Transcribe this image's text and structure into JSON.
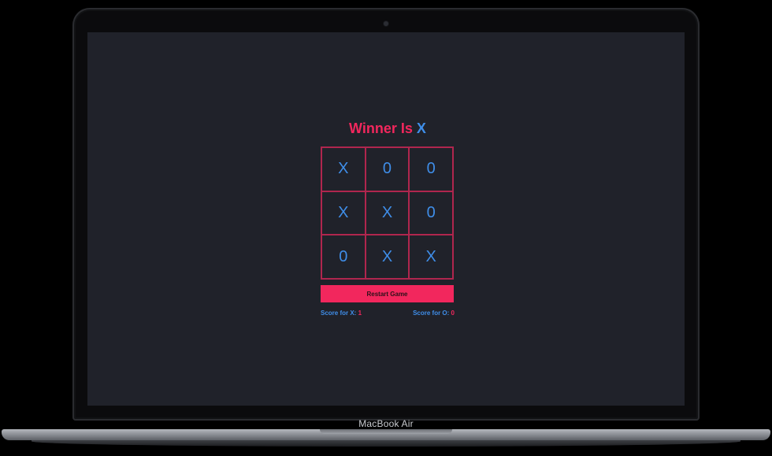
{
  "device": {
    "label": "MacBook Air"
  },
  "game": {
    "title_prefix": "Winner Is",
    "winner": "X",
    "board": [
      "X",
      "0",
      "0",
      "X",
      "X",
      "0",
      "0",
      "X",
      "X"
    ],
    "restart_label": "Restart Game",
    "score_x_label": "Score for X:",
    "score_x_value": "1",
    "score_o_label": "Score for O:",
    "score_o_value": "0"
  },
  "colors": {
    "background": "#20222a",
    "accent": "#f2275d",
    "mark": "#3f8ee9",
    "grid": "#b0264e"
  }
}
